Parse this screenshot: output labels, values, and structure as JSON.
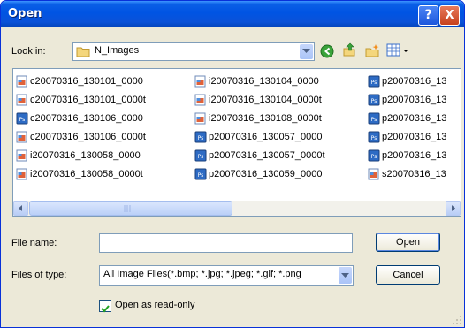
{
  "window": {
    "title": "Open"
  },
  "title_buttons": {
    "help": "?",
    "close": "X"
  },
  "toolbar": {
    "look_in_label": "Look in:",
    "folder": "N_Images",
    "icons": [
      "back-icon",
      "up-folder-icon",
      "new-folder-icon",
      "views-menu-icon"
    ]
  },
  "files": [
    {
      "name": "c20070316_130101_0000",
      "icon": "image-file-icon"
    },
    {
      "name": "c20070316_130101_0000t",
      "icon": "image-file-icon"
    },
    {
      "name": "c20070316_130106_0000",
      "icon": "photoshop-file-icon"
    },
    {
      "name": "c20070316_130106_0000t",
      "icon": "image-file-icon"
    },
    {
      "name": "i20070316_130058_0000",
      "icon": "image-file-icon"
    },
    {
      "name": "i20070316_130058_0000t",
      "icon": "image-file-icon"
    },
    {
      "name": "i20070316_130104_0000",
      "icon": "image-file-icon"
    },
    {
      "name": "i20070316_130104_0000t",
      "icon": "image-file-icon"
    },
    {
      "name": "i20070316_130108_0000t",
      "icon": "image-file-icon"
    },
    {
      "name": "p20070316_130057_0000",
      "icon": "photoshop-file-icon"
    },
    {
      "name": "p20070316_130057_0000t",
      "icon": "photoshop-file-icon"
    },
    {
      "name": "p20070316_130059_0000",
      "icon": "photoshop-file-icon"
    },
    {
      "name": "p20070316_13",
      "icon": "photoshop-file-icon"
    },
    {
      "name": "p20070316_13",
      "icon": "photoshop-file-icon"
    },
    {
      "name": "p20070316_13",
      "icon": "photoshop-file-icon"
    },
    {
      "name": "p20070316_13",
      "icon": "photoshop-file-icon"
    },
    {
      "name": "p20070316_13",
      "icon": "photoshop-file-icon"
    },
    {
      "name": "s20070316_13",
      "icon": "image-file-icon"
    }
  ],
  "file_name": {
    "label": "File name:",
    "value": ""
  },
  "file_type": {
    "label": "Files of type:",
    "value": "All Image Files(*.bmp; *.jpg; *.jpeg; *.gif; *.png"
  },
  "buttons": {
    "open": "Open",
    "cancel": "Cancel"
  },
  "read_only": {
    "label": "Open as read-only",
    "checked": true
  }
}
